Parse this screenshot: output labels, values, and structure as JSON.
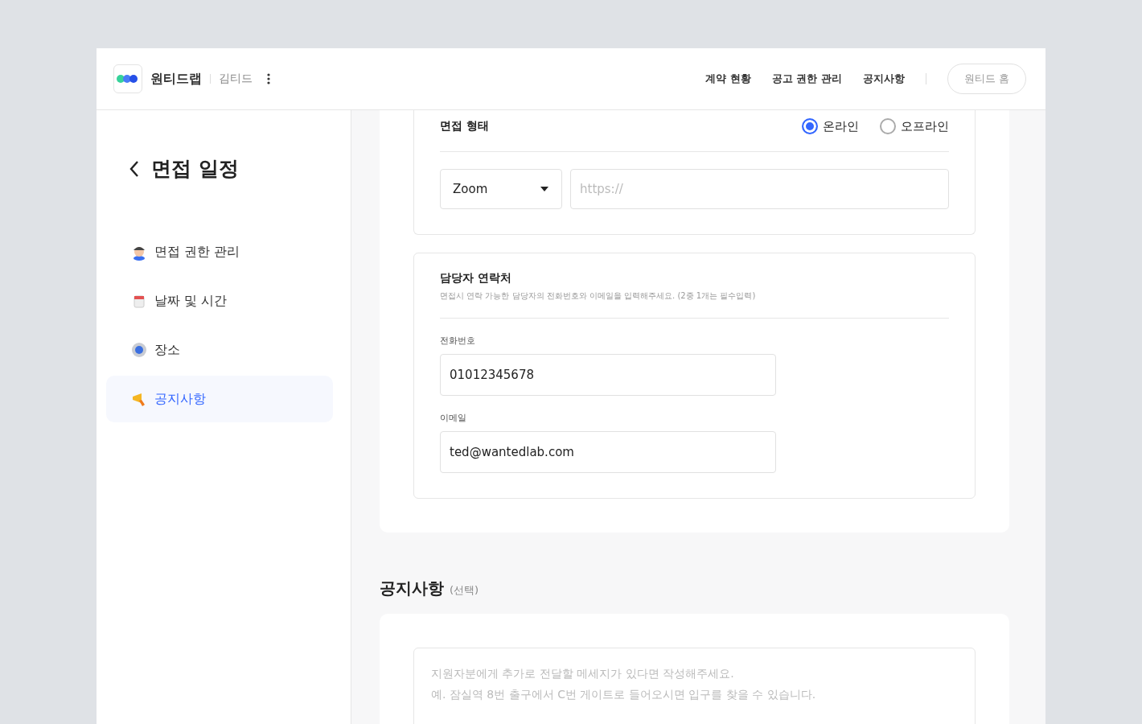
{
  "header": {
    "brand": "원티드랩",
    "user": "김티드",
    "nav": [
      "계약 현황",
      "공고 권한 관리",
      "공지사항"
    ],
    "home_button": "원티드 홈"
  },
  "sidebar": {
    "title": "면접 일정",
    "items": [
      {
        "label": "면접 권한 관리",
        "kind": "person",
        "selected": false
      },
      {
        "label": "날짜 및 시간",
        "kind": "calendar",
        "selected": false
      },
      {
        "label": "장소",
        "kind": "pin",
        "selected": false
      },
      {
        "label": "공지사항",
        "kind": "megaphone",
        "selected": true
      }
    ]
  },
  "interview_type": {
    "label": "면접 형태",
    "options": [
      {
        "label": "온라인",
        "selected": true
      },
      {
        "label": "오프라인",
        "selected": false
      }
    ],
    "platform": "Zoom",
    "url_placeholder": "https://"
  },
  "contact": {
    "title": "담당자 연락처",
    "description": "면접시 연락 가능한 담당자의 전화번호와 이메일을 입력해주세요. (2중 1개는 필수입력)",
    "phone_label": "전화번호",
    "phone": "01012345678",
    "email_label": "이메일",
    "email": "ted@wantedlab.com"
  },
  "notice": {
    "title": "공지사항",
    "optional": "(선택)",
    "placeholder": "지원자분에게 추가로 전달할 메세지가 있다면 작성해주세요.\n예. 잠실역 8번 출구에서 C번 게이트로 들어오시면 입구를 찾을 수 있습니다."
  }
}
